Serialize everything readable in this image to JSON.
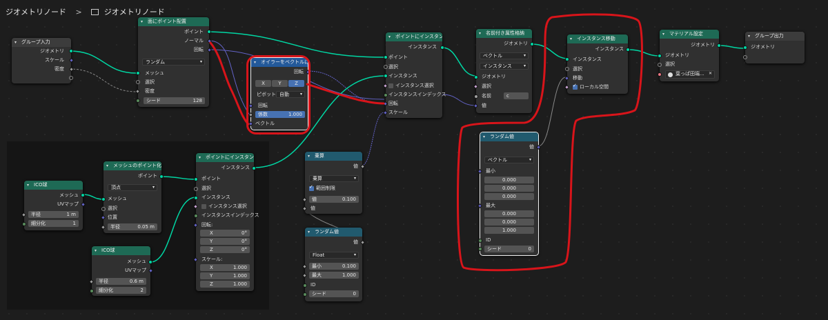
{
  "breadcrumb": {
    "root": "ジオメトリノード",
    "sep": ">",
    "current": "ジオメトリノード"
  },
  "nodes": {
    "group_input": {
      "title": "グループ入力",
      "geometry": "ジオメトリ",
      "scale": "スケール",
      "density": "密度"
    },
    "distribute": {
      "title": "面にポイント配置",
      "points": "ポイント",
      "normal": "ノーマル",
      "rotation": "回転",
      "mode": "ランダム",
      "mesh": "メッシュ",
      "selection": "選択",
      "density": "密度",
      "seed_label": "シード",
      "seed": "128"
    },
    "euler": {
      "title": "オイラーをベクトルに...",
      "rotation": "回転",
      "x": "X",
      "y": "Y",
      "z": "Z",
      "pivot_label": "ピボット",
      "pivot": "自動",
      "rotation_in": "回転",
      "factor_label": "係数",
      "factor": "1.000",
      "vector": "ベクトル"
    },
    "instance1": {
      "title": "ポイントにインスタン...",
      "instances": "インスタンス",
      "points": "ポイント",
      "selection": "選択",
      "instance": "インスタンス",
      "instance_sel": "インスタンス選択",
      "instance_index": "インスタンスインデックス",
      "rotation": "回転",
      "scale": "スケール"
    },
    "store_attr": {
      "title": "名前付き属性格納",
      "geometry_out": "ジオメトリ",
      "type": "ベクトル",
      "domain": "インスタンス",
      "geometry": "ジオメトリ",
      "selection": "選択",
      "name_label": "名前",
      "name": "c",
      "value": "値"
    },
    "translate": {
      "title": "インスタンス移動",
      "instances_out": "インスタンス",
      "instances": "インスタンス",
      "selection": "選択",
      "translation": "移動",
      "local": "ローカル空間"
    },
    "material": {
      "title": "マテリアル設定",
      "geometry_out": "ジオメトリ",
      "geometry": "ジオメトリ",
      "selection": "選択",
      "material": "葉っぱ田端..."
    },
    "group_output": {
      "title": "グループ出力",
      "geometry": "ジオメトリ"
    },
    "random_vec": {
      "title": "ランダム値",
      "value": "値",
      "type": "ベクトル",
      "min_label": "最小",
      "min": [
        "0.000",
        "0.000",
        "0.000"
      ],
      "max_label": "最大",
      "max": [
        "0.000",
        "0.000",
        "1.000"
      ],
      "id": "ID",
      "seed_label": "シード",
      "seed": "0"
    },
    "math": {
      "title": "乗算",
      "value": "値",
      "op": "乗算",
      "clamp": "範囲制限",
      "value_label": "値",
      "value_num": "0.100",
      "value2": "値"
    },
    "random_flt": {
      "title": "ランダム値",
      "value": "値",
      "type": "Float",
      "min_label": "最小",
      "min": "0.100",
      "max_label": "最大",
      "max": "1.000",
      "id": "ID",
      "seed_label": "シード",
      "seed": "0"
    },
    "ico1": {
      "title": "ICO球",
      "mesh": "メッシュ",
      "uv": "UVマップ",
      "radius_label": "半径",
      "radius": "1 m",
      "subdiv_label": "細分化",
      "subdiv": "1"
    },
    "mesh_to_pts": {
      "title": "メッシュのポイント化",
      "points": "ポイント",
      "mode": "頂点",
      "mesh": "メッシュ",
      "selection": "選択",
      "position": "位置",
      "radius_label": "半径",
      "radius": "0.05 m"
    },
    "instance2": {
      "title": "ポイントにインスタン...",
      "instances": "インスタンス",
      "points": "ポイント",
      "selection": "選択",
      "instance": "インスタンス",
      "instance_sel": "インスタンス選択",
      "instance_index": "インスタンスインデックス",
      "rotation": "回転:",
      "rx_label": "X",
      "rx": "0°",
      "ry_label": "Y",
      "ry": "0°",
      "rz_label": "Z",
      "rz": "0°",
      "scale": "スケール:",
      "sx_label": "X",
      "sx": "1.000",
      "sy_label": "Y",
      "sy": "1.000",
      "sz_label": "Z",
      "sz": "1.000"
    },
    "ico2": {
      "title": "ICO球",
      "mesh": "メッシュ",
      "uv": "UVマップ",
      "radius_label": "半径",
      "radius": "0.6 m",
      "subdiv_label": "細分化",
      "subdiv": "2"
    }
  },
  "colors": {
    "geometry_wire": "#00d6a3",
    "vector_wire": "#6363c7",
    "float_wire": "#a1a1a1",
    "annotation": "#d8141a"
  }
}
